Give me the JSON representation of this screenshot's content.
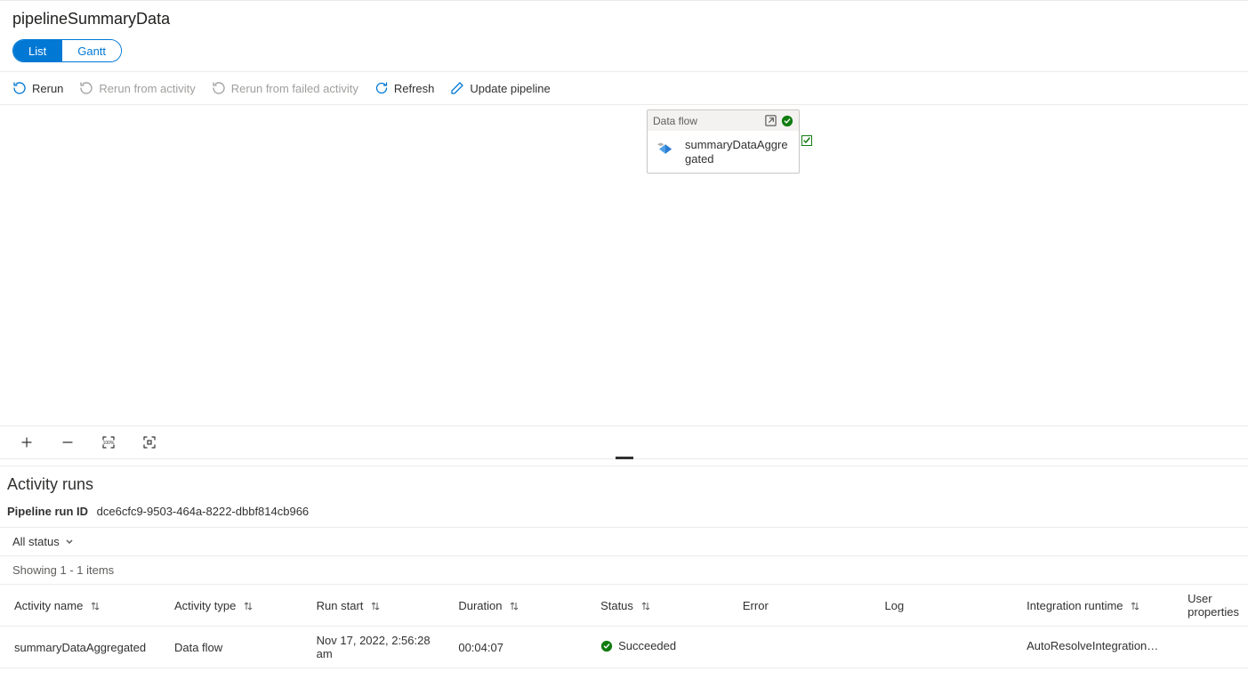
{
  "header": {
    "title": "pipelineSummaryData"
  },
  "viewToggle": {
    "list": "List",
    "gantt": "Gantt"
  },
  "toolbar": {
    "rerun": "Rerun",
    "rerunFromActivity": "Rerun from activity",
    "rerunFromFailed": "Rerun from failed activity",
    "refresh": "Refresh",
    "updatePipeline": "Update pipeline"
  },
  "activityCard": {
    "type": "Data flow",
    "name": "summaryDataAggregated"
  },
  "activityRuns": {
    "heading": "Activity runs",
    "runIdLabel": "Pipeline run ID",
    "runId": "dce6cfc9-9503-464a-8222-dbbf814cb966",
    "statusFilter": "All status",
    "itemsShowing": "Showing 1 - 1 items",
    "columns": {
      "activityName": "Activity name",
      "activityType": "Activity type",
      "runStart": "Run start",
      "duration": "Duration",
      "status": "Status",
      "error": "Error",
      "log": "Log",
      "integrationRuntime": "Integration runtime",
      "userProperties": "User properties"
    },
    "rows": [
      {
        "activityName": "summaryDataAggregated",
        "activityType": "Data flow",
        "runStart": "Nov 17, 2022, 2:56:28 am",
        "duration": "00:04:07",
        "status": "Succeeded",
        "error": "",
        "log": "",
        "integrationRuntime": "AutoResolveIntegrationRunti",
        "userProperties": ""
      }
    ]
  }
}
